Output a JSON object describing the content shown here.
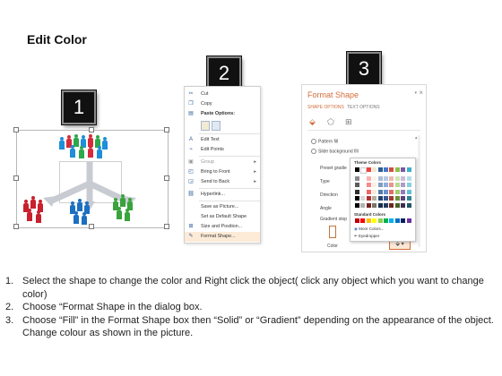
{
  "page": {
    "title": "Edit Color"
  },
  "steps": [
    {
      "number": "1"
    },
    {
      "number": "2"
    },
    {
      "number": "3"
    }
  ],
  "context_menu": {
    "items": [
      {
        "label": "Cut",
        "icon": "scissors-icon"
      },
      {
        "label": "Copy",
        "icon": "copy-icon"
      },
      {
        "label": "Paste Options:",
        "icon": "clipboard-icon"
      },
      {
        "label": "",
        "icon": "paste-option-icons"
      },
      {
        "label": "Edit Text",
        "icon": "edit-text-icon"
      },
      {
        "label": "Edit Points",
        "icon": "edit-points-icon"
      },
      {
        "label": "Group",
        "icon": "group-icon"
      },
      {
        "label": "Bring to Front",
        "icon": "bring-to-front-icon"
      },
      {
        "label": "Send to Back",
        "icon": "send-to-back-icon"
      },
      {
        "label": "Hyperlink...",
        "icon": "hyperlink-icon"
      },
      {
        "label": "Save as Picture...",
        "icon": ""
      },
      {
        "label": "Set as Default Shape",
        "icon": ""
      },
      {
        "label": "Size and Position...",
        "icon": "size-position-icon"
      },
      {
        "label": "Format Shape...",
        "icon": "format-shape-icon"
      }
    ]
  },
  "format_pane": {
    "title": "Format Shape",
    "tabs": {
      "shape_options": "SHAPE OPTIONS",
      "text_options": "TEXT OPTIONS"
    },
    "options": {
      "pattern_fill": "Pattern fill",
      "slide_background_fill": "Slide background fill"
    },
    "fields": {
      "preset": "Preset gradie",
      "type": "Type",
      "direction": "Direction",
      "angle": "Angle",
      "gradient_stops": "Gradient stop",
      "color": "Color"
    }
  },
  "color_palette": {
    "theme_colors_label": "Theme Colors",
    "standard_colors_label": "Standard Colors",
    "more_colors": "More Colors...",
    "eyedropper": "Eyedropper",
    "theme_top": [
      "#000000",
      "#ffffff",
      "#ee3f3f",
      "#f0e7d2",
      "#2b5b95",
      "#4677c3",
      "#d44e3d",
      "#8ebf4f",
      "#7a59a1",
      "#3cb0c7"
    ],
    "standard": [
      "#c00000",
      "#ff0000",
      "#ffc000",
      "#ffff00",
      "#92d050",
      "#00b050",
      "#00b0f0",
      "#0070c0",
      "#002060",
      "#7030a0"
    ]
  },
  "instructions": [
    {
      "num": "1.",
      "text": "Select the shape to change the color and Right click the object( click any object which you want to change color)"
    },
    {
      "num": "2.",
      "text": "Choose “Format Shape in the dialog box."
    },
    {
      "num": "3.",
      "text": "Choose “Fill” in the Format Shape box then “Solid” or “Gradient” depending on the appearance of the object. Change colour as shown in the picture."
    }
  ]
}
